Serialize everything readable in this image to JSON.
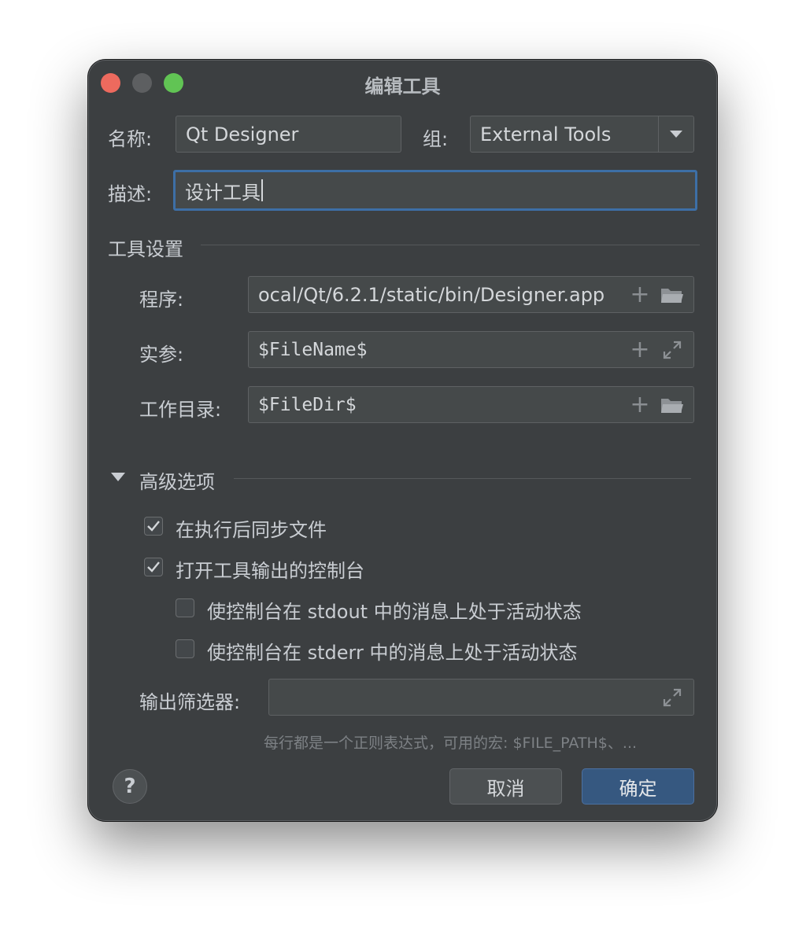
{
  "window": {
    "title": "编辑工具"
  },
  "form": {
    "name_label": "名称:",
    "name_value": "Qt Designer",
    "group_label": "组:",
    "group_value": "External Tools",
    "desc_label": "描述:",
    "desc_value": "设计工具"
  },
  "tool_settings": {
    "section_title": "工具设置",
    "program_label": "程序:",
    "program_value": "ocal/Qt/6.2.1/static/bin/Designer.app",
    "args_label": "实参:",
    "args_value": "$FileName$",
    "workdir_label": "工作目录:",
    "workdir_value": "$FileDir$"
  },
  "advanced": {
    "section_title": "高级选项",
    "expanded": true,
    "options": [
      {
        "label": "在执行后同步文件",
        "checked": true
      },
      {
        "label": "打开工具输出的控制台",
        "checked": true
      },
      {
        "label": "使控制台在 stdout 中的消息上处于活动状态",
        "checked": false
      },
      {
        "label": "使控制台在 stderr 中的消息上处于活动状态",
        "checked": false
      }
    ],
    "filter_label": "输出筛选器:",
    "filter_value": "",
    "filter_hint": "每行都是一个正则表达式，可用的宏: $FILE_PATH$、..."
  },
  "buttons": {
    "help": "?",
    "cancel": "取消",
    "ok": "确定"
  },
  "colors": {
    "window_bg": "#3c3f41",
    "accent": "#365880",
    "focus_border": "#3d6fa6"
  }
}
